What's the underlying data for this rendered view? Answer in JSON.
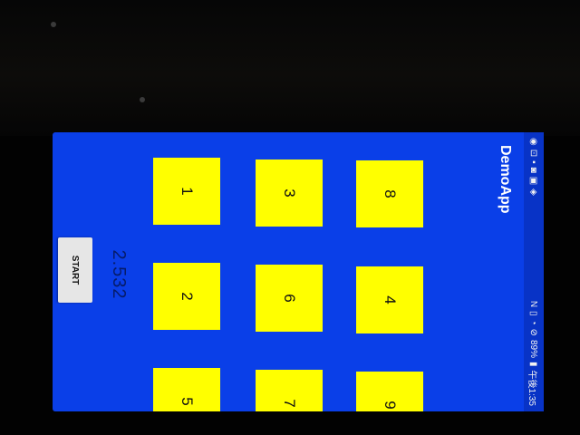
{
  "status_bar": {
    "time": "午後1:35",
    "battery": "89%",
    "left_icons": [
      "notification-icon",
      "notification-icon",
      "notification-icon",
      "notification-icon",
      "notification-icon",
      "notification-icon"
    ],
    "right_icons": [
      "nfc-icon",
      "vibrate-icon",
      "wifi-icon",
      "no-sim-icon",
      "battery-icon"
    ]
  },
  "app_bar": {
    "title": "DemoApp"
  },
  "tiles": [
    "1",
    "2",
    "5",
    "3",
    "6",
    "7",
    "8",
    "4",
    "9"
  ],
  "timer": "2.532",
  "start_button": "START",
  "colors": {
    "background": "#0a3fe8",
    "tile": "#ffff00"
  }
}
